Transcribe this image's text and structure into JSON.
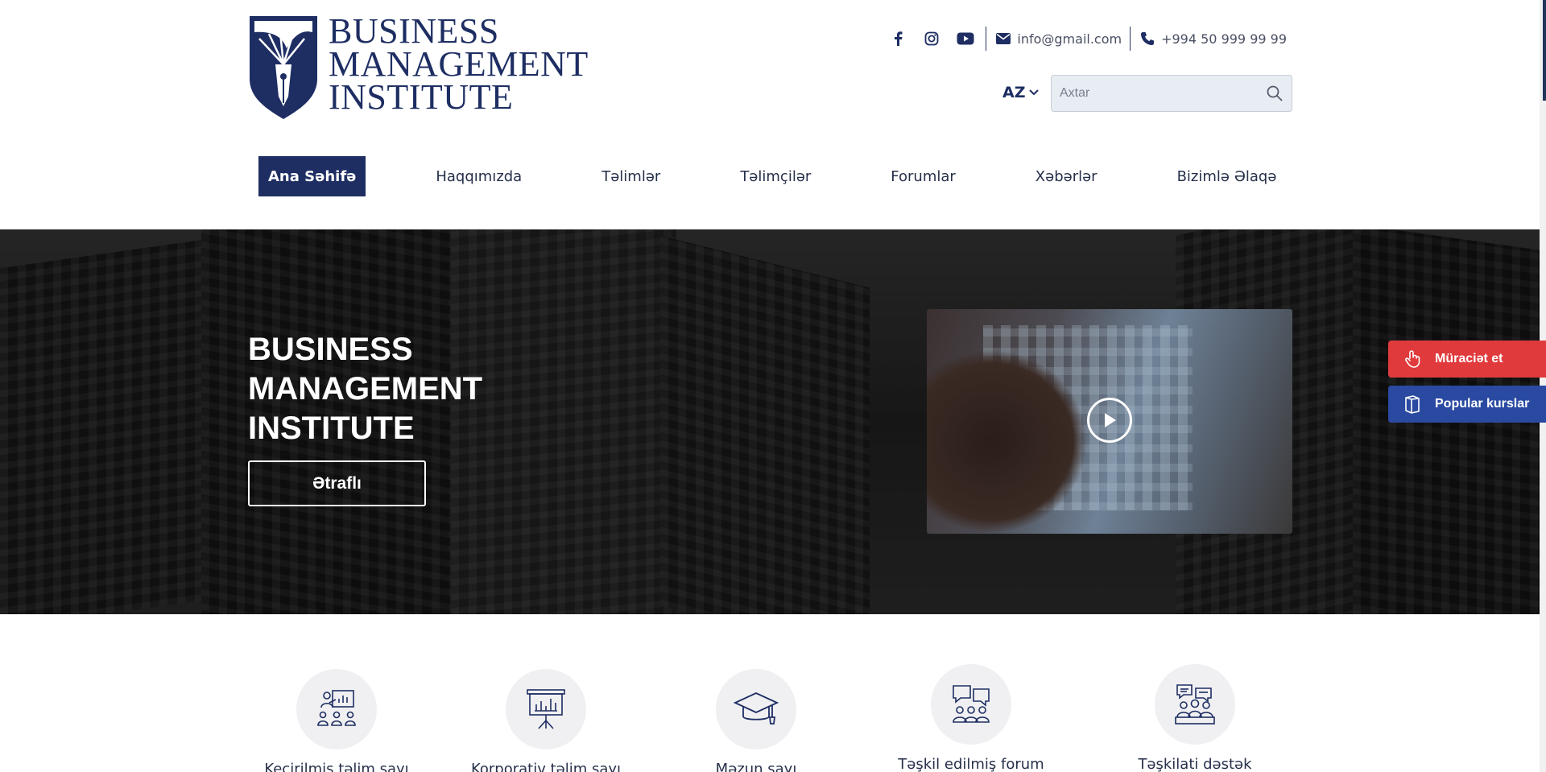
{
  "logo": {
    "line1": "BUSINESS",
    "line2": "MANAGEMENT",
    "line3": "INSTITUTE"
  },
  "contacts": {
    "social_icons": [
      "facebook-icon",
      "instagram-icon",
      "youtube-icon"
    ],
    "email": "info@gmail.com",
    "phone": "+994 50 999 99 99"
  },
  "lang": {
    "current": "AZ"
  },
  "search": {
    "placeholder": "Axtar",
    "value": ""
  },
  "nav": {
    "items": [
      {
        "label": "Ana Səhifə",
        "active": true
      },
      {
        "label": "Haqqımızda"
      },
      {
        "label": "Təlimlər"
      },
      {
        "label": "Təlimçilər"
      },
      {
        "label": "Forumlar"
      },
      {
        "label": "Xəbərlər"
      },
      {
        "label": "Bizimlə Əlaqə"
      }
    ]
  },
  "hero": {
    "title_line1": "BUSINESS",
    "title_line2": "MANAGEMENT",
    "title_line3": "INSTITUTE",
    "button": "Ətraflı"
  },
  "floating": {
    "apply": "Müraciət et",
    "popular": "Popular kurslar"
  },
  "stats": [
    {
      "label": "Keçirilmiş təlim sayı",
      "icon": "training-presentation-icon"
    },
    {
      "label": "Korporativ təlim sayı",
      "icon": "chart-board-icon"
    },
    {
      "label": "Məzun sayı",
      "icon": "graduation-cap-icon"
    },
    {
      "label": "Təşkil edilmiş forum",
      "icon": "forum-chat-icon"
    },
    {
      "label": "Təşkilati dəstək",
      "icon": "team-support-icon"
    }
  ],
  "colors": {
    "brand": "#1e2e63",
    "apply_red": "#e03a3c",
    "popular_blue": "#2a4aa2"
  }
}
